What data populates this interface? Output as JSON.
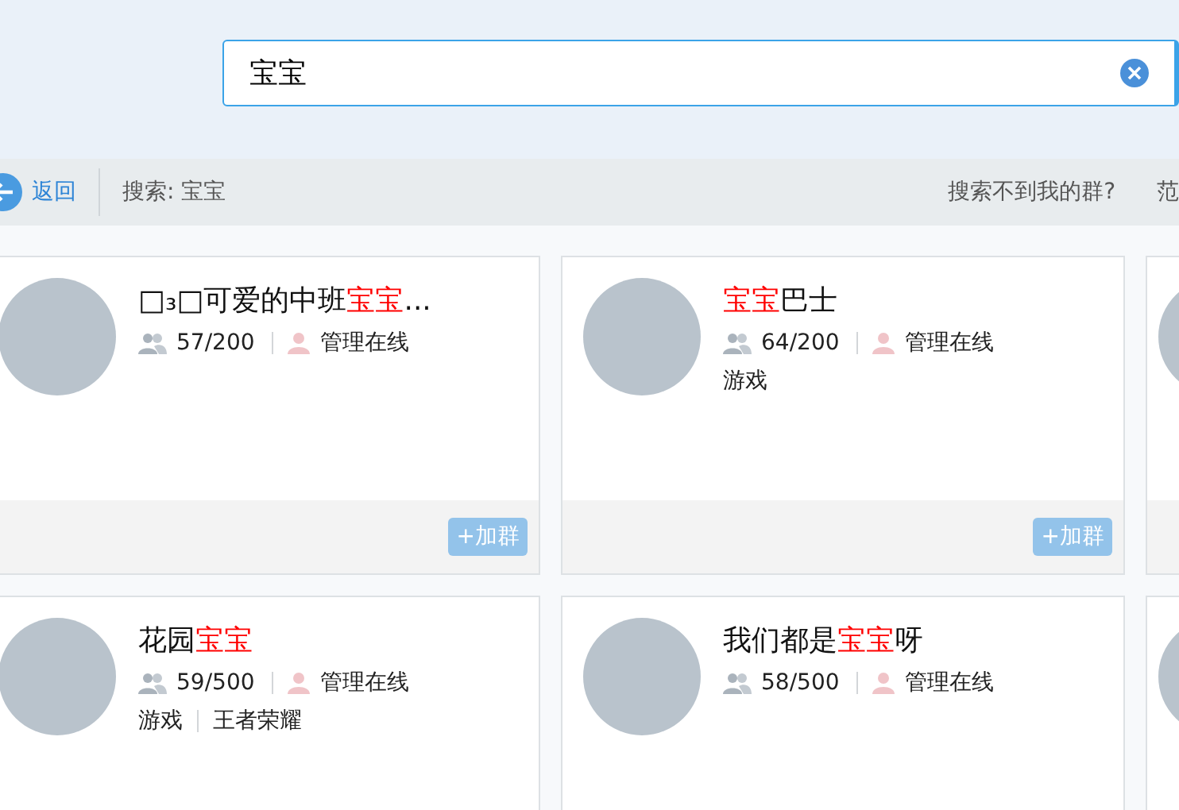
{
  "search": {
    "value": "宝宝"
  },
  "toolbar": {
    "back": "返回",
    "query": "搜索: 宝宝",
    "help_link": "搜索不到我的群?",
    "scope": "范"
  },
  "groups": [
    {
      "kind": "full",
      "title": [
        {
          "text": "□₃□可爱的中班",
          "highlight": false
        },
        {
          "text": "宝宝",
          "highlight": true
        },
        {
          "text": "...",
          "highlight": false
        }
      ],
      "members": "57/200",
      "admin": "管理在线",
      "join": "+加群"
    },
    {
      "kind": "full",
      "title": [
        {
          "text": "宝宝",
          "highlight": true
        },
        {
          "text": "巴士",
          "highlight": false
        }
      ],
      "members": "64/200",
      "admin": "管理在线",
      "tags": [
        "游戏"
      ],
      "join": "+加群"
    },
    {
      "kind": "cut_off"
    },
    {
      "kind": "full",
      "title": [
        {
          "text": "花园",
          "highlight": false
        },
        {
          "text": "宝宝",
          "highlight": true
        }
      ],
      "members": "59/500",
      "admin": "管理在线",
      "tags": [
        "游戏",
        "王者荣耀"
      ]
    },
    {
      "kind": "full",
      "title": [
        {
          "text": "我们都是",
          "highlight": false
        },
        {
          "text": "宝宝",
          "highlight": true
        },
        {
          "text": "呀",
          "highlight": false
        }
      ],
      "members": "58/500",
      "admin": "管理在线"
    },
    {
      "kind": "cut_off"
    }
  ]
}
